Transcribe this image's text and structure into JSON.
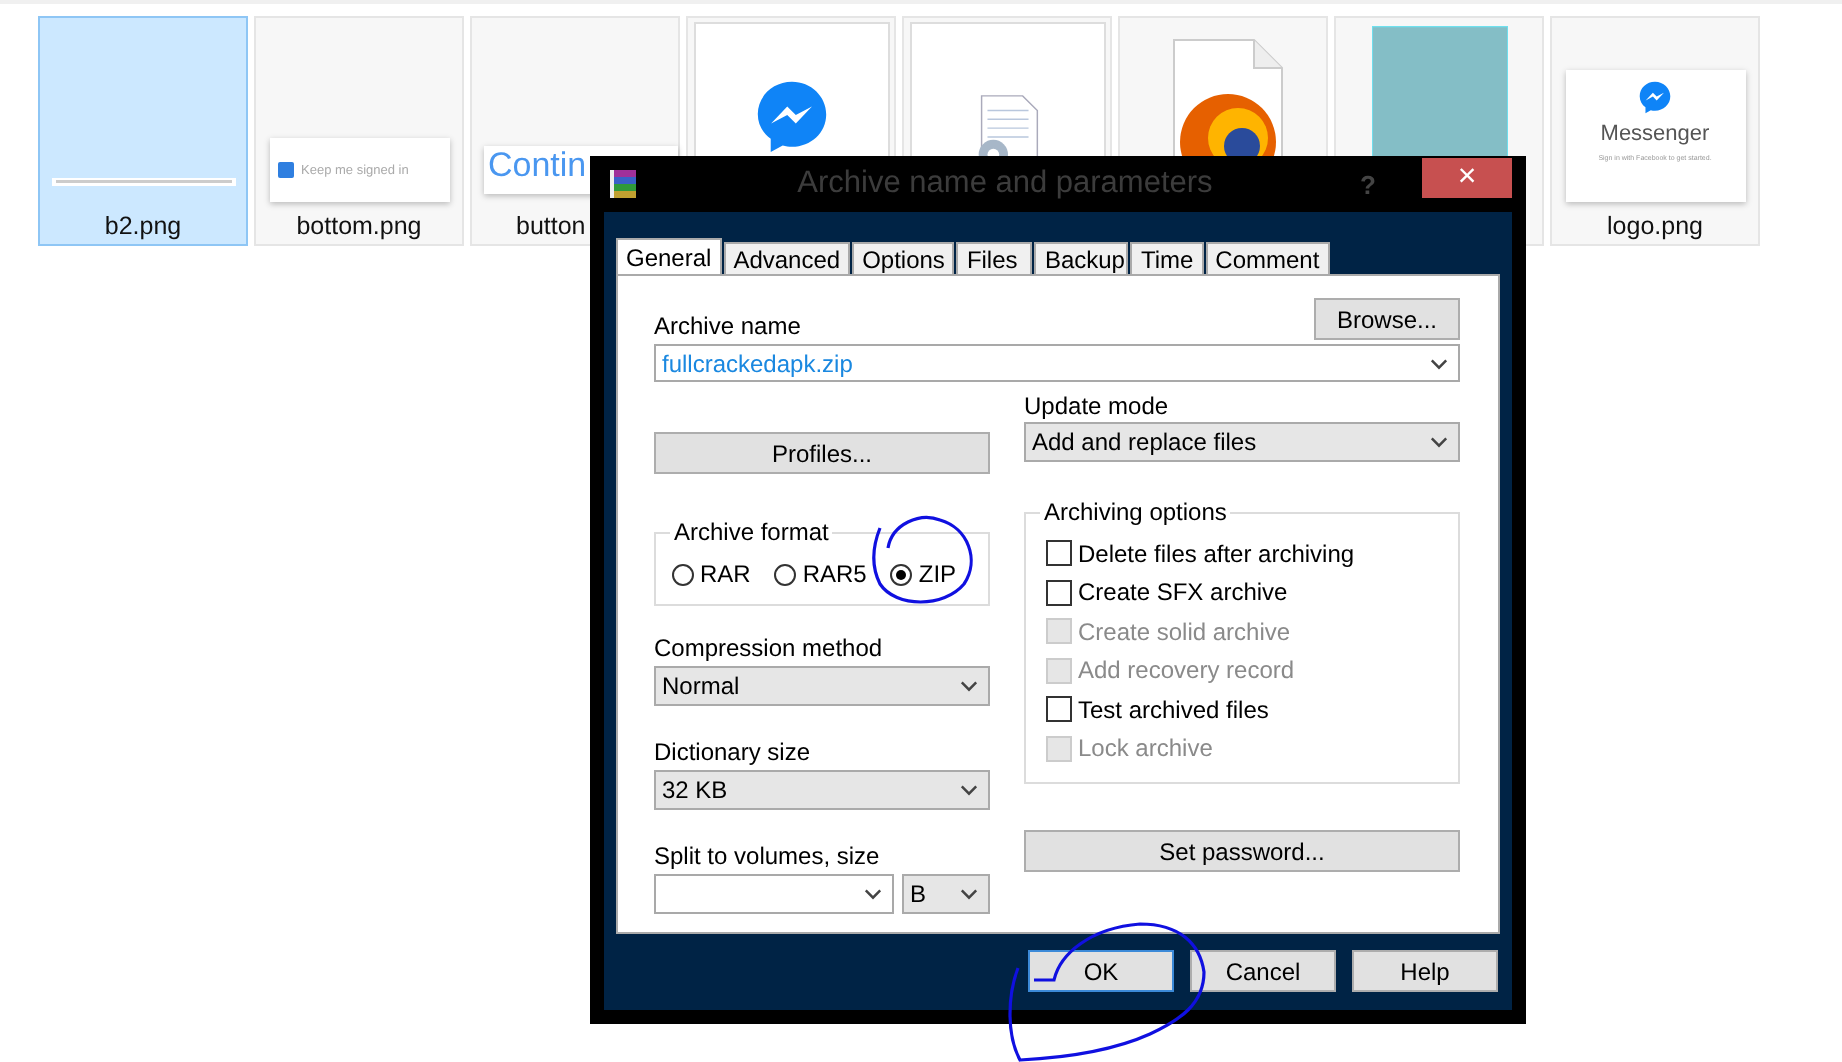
{
  "thumbnails": [
    {
      "name": "b2.png",
      "selected": true,
      "kind": "strip"
    },
    {
      "name": "bottom.png",
      "selected": false,
      "kind": "checkbox-card",
      "text": "Keep me signed in"
    },
    {
      "name": "button",
      "selected": false,
      "kind": "text-card",
      "text": "Contin"
    },
    {
      "selected": false,
      "kind": "messenger"
    },
    {
      "selected": false,
      "kind": "config-file"
    },
    {
      "selected": false,
      "kind": "browser-file"
    },
    {
      "selected": false,
      "kind": "teal"
    },
    {
      "name": "logo.png",
      "selected": false,
      "kind": "logo-card",
      "text": "Messenger",
      "subtext": "Sign in with Facebook to get started."
    }
  ],
  "dialog": {
    "title": "Archive name and parameters",
    "help": "?",
    "close": "×",
    "tabs": [
      {
        "label": "General",
        "selected": true
      },
      {
        "label": "Advanced",
        "selected": false
      },
      {
        "label": "Options",
        "selected": false
      },
      {
        "label": "Files",
        "selected": false
      },
      {
        "label": "Backup",
        "selected": false
      },
      {
        "label": "Time",
        "selected": false
      },
      {
        "label": "Comment",
        "selected": false
      }
    ],
    "archive_name": {
      "label": "Archive name",
      "value": "fullcrackedapk.zip"
    },
    "browse": "Browse...",
    "profiles": "Profiles...",
    "update_mode": {
      "label": "Update mode",
      "value": "Add and replace files"
    },
    "archive_format": {
      "label": "Archive format",
      "options": [
        {
          "label": "RAR",
          "selected": false
        },
        {
          "label": "RAR5",
          "selected": false
        },
        {
          "label": "ZIP",
          "selected": true
        }
      ]
    },
    "archiving_options": {
      "label": "Archiving options",
      "options": [
        {
          "label": "Delete files after archiving",
          "checked": false,
          "disabled": false
        },
        {
          "label": "Create SFX archive",
          "checked": false,
          "disabled": false
        },
        {
          "label": "Create solid archive",
          "checked": false,
          "disabled": true
        },
        {
          "label": "Add recovery record",
          "checked": false,
          "disabled": true
        },
        {
          "label": "Test archived files",
          "checked": false,
          "disabled": false
        },
        {
          "label": "Lock archive",
          "checked": false,
          "disabled": true
        }
      ]
    },
    "compression_method": {
      "label": "Compression method",
      "value": "Normal"
    },
    "dictionary_size": {
      "label": "Dictionary size",
      "value": "32 KB"
    },
    "split": {
      "label": "Split to volumes, size",
      "unit": "B"
    },
    "set_password": "Set password...",
    "buttons": [
      {
        "label": "OK",
        "default": true
      },
      {
        "label": "Cancel",
        "default": false
      },
      {
        "label": "Help",
        "default": false
      }
    ]
  }
}
